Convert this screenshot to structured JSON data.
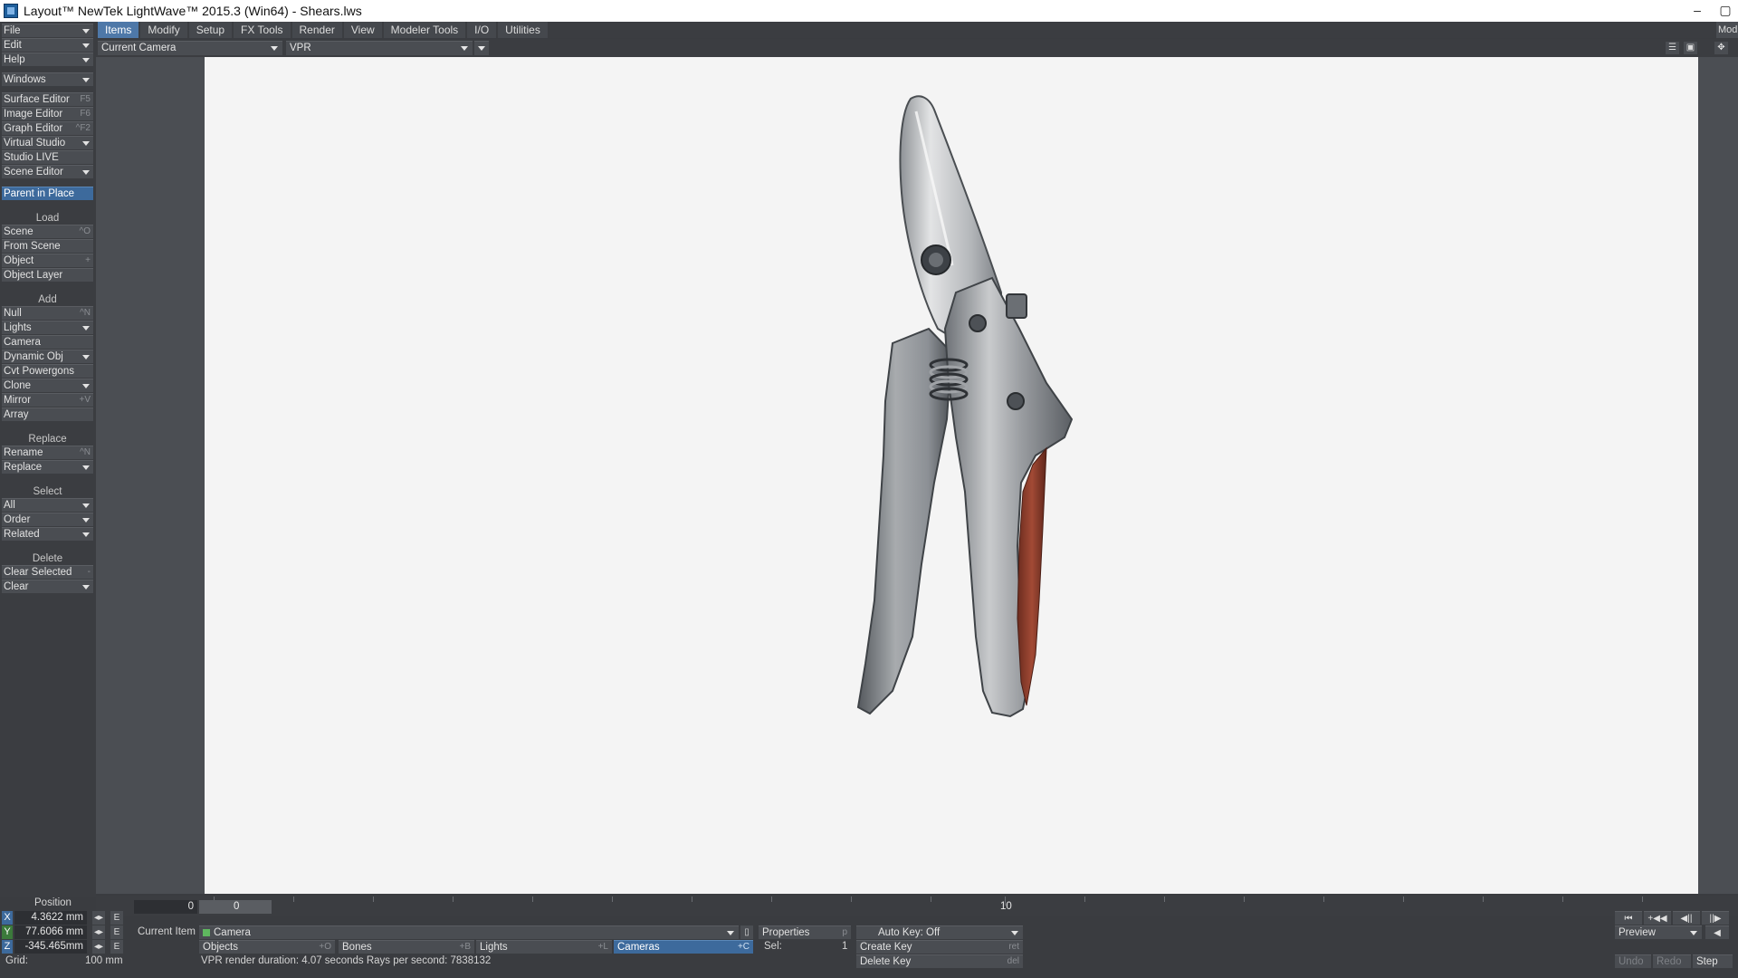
{
  "window": {
    "title": "Layout™ NewTek LightWave™ 2015.3 (Win64) - Shears.lws",
    "minimize_glyph": "–",
    "restore_glyph": "▢"
  },
  "menu_tabs": [
    {
      "label": "Items",
      "active": true
    },
    {
      "label": "Modify"
    },
    {
      "label": "Setup"
    },
    {
      "label": "FX Tools"
    },
    {
      "label": "Render"
    },
    {
      "label": "View"
    },
    {
      "label": "Modeler Tools"
    },
    {
      "label": "I/O"
    },
    {
      "label": "Utilities"
    }
  ],
  "menu_right_label": "Mod",
  "left_panel": {
    "file": "File",
    "edit": "Edit",
    "help": "Help",
    "windows": "Windows",
    "surface_editor": {
      "label": "Surface Editor",
      "shortcut": "F5"
    },
    "image_editor": {
      "label": "Image Editor",
      "shortcut": "F6"
    },
    "graph_editor": {
      "label": "Graph Editor",
      "shortcut": "^F2"
    },
    "virtual_studio": "Virtual Studio",
    "studio_live": "Studio LIVE",
    "scene_editor": "Scene Editor",
    "parent_in_place": "Parent in Place",
    "load_header": "Load",
    "load_scene": {
      "label": "Scene",
      "shortcut": "^O"
    },
    "from_scene": "From Scene",
    "load_object": {
      "label": "Object",
      "shortcut": "+"
    },
    "object_layer": "Object Layer",
    "add_header": "Add",
    "add_null": {
      "label": "Null",
      "shortcut": "^N"
    },
    "add_lights": "Lights",
    "add_camera": "Camera",
    "dynamic_obj": "Dynamic Obj",
    "cvt_powergons": "Cvt Powergons",
    "clone": "Clone",
    "mirror": {
      "label": "Mirror",
      "shortcut": "+V"
    },
    "array": "Array",
    "replace_header": "Replace",
    "rename": {
      "label": "Rename",
      "shortcut": "^N"
    },
    "replace": "Replace",
    "select_header": "Select",
    "select_all": "All",
    "order": "Order",
    "related": "Related",
    "delete_header": "Delete",
    "clear_selected": {
      "label": "Clear Selected",
      "shortcut": "-"
    },
    "clear": "Clear"
  },
  "viewport_header": {
    "camera_select": "Current Camera",
    "render_mode": "VPR"
  },
  "timeline": {
    "frame_start": "0",
    "current_frame": "0",
    "frame_label_10": "10"
  },
  "bottom": {
    "position_label": "Position",
    "x": {
      "axis": "X",
      "value": "4.3622 mm",
      "color": "#3d6a9c"
    },
    "y": {
      "axis": "Y",
      "value": "77.6066 mm",
      "color": "#3b7a3b"
    },
    "z": {
      "axis": "Z",
      "value": "-345.465mm",
      "color": "#3d6a9c"
    },
    "envelope_btn": "E",
    "grid_label": "Grid:",
    "grid_value": "100 mm",
    "current_item_label": "Current Item",
    "current_item": "Camera",
    "properties": {
      "label": "Properties",
      "shortcut": "p"
    },
    "auto_key": "Auto Key: Off",
    "objects": {
      "label": "Objects",
      "shortcut": "+O"
    },
    "bones": {
      "label": "Bones",
      "shortcut": "+B"
    },
    "lights": {
      "label": "Lights",
      "shortcut": "+L"
    },
    "cameras": {
      "label": "Cameras",
      "shortcut": "+C"
    },
    "sel_label": "Sel:",
    "sel_value": "1",
    "create_key": {
      "label": "Create Key",
      "shortcut": "ret"
    },
    "delete_key": {
      "label": "Delete Key",
      "shortcut": "del"
    },
    "status": "VPR render duration: 4.07 seconds  Rays per second: 7838132",
    "preview": "Preview",
    "undo": "Undo",
    "redo": "Redo",
    "step": "Step",
    "transport": [
      "⏮",
      "+◀◀",
      "◀||",
      "||▶"
    ]
  }
}
